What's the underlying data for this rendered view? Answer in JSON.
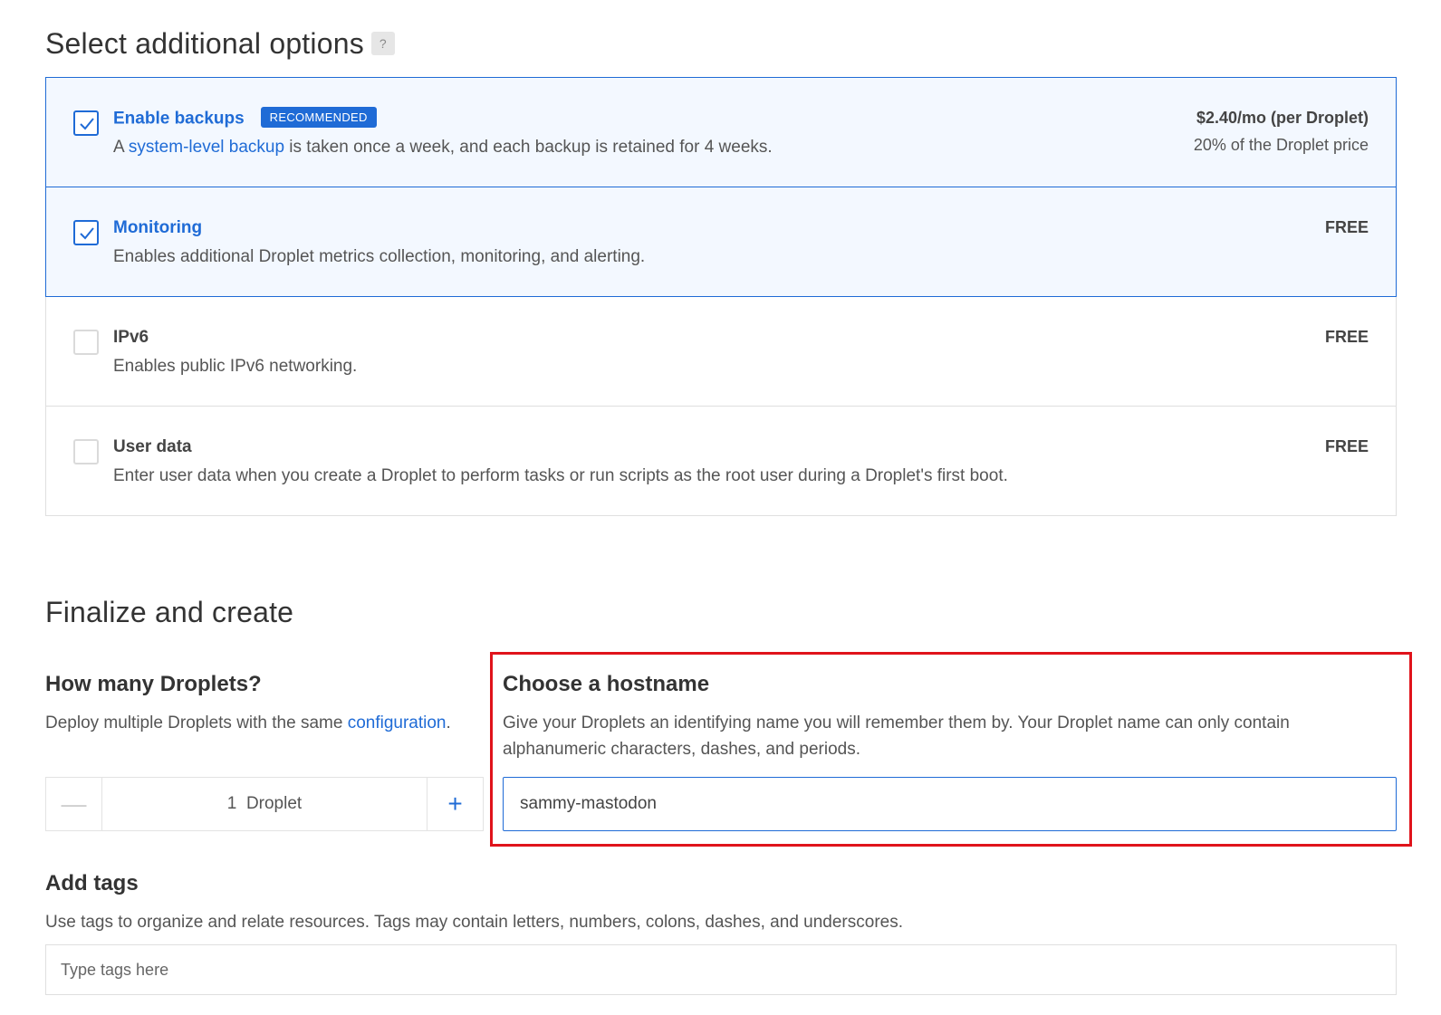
{
  "additional_options": {
    "title": "Select additional options",
    "help_badge": "?",
    "items": [
      {
        "title": "Enable backups",
        "badge": "RECOMMENDED",
        "desc_prefix": "A ",
        "desc_link": "system-level backup",
        "desc_suffix": " is taken once a week, and each backup is retained for 4 weeks.",
        "price": "$2.40/mo (per Droplet)",
        "price_sub": "20% of the Droplet price",
        "checked": true
      },
      {
        "title": "Monitoring",
        "desc": "Enables additional Droplet metrics collection, monitoring, and alerting.",
        "price": "FREE",
        "checked": true
      },
      {
        "title": "IPv6",
        "desc": "Enables public IPv6 networking.",
        "price": "FREE",
        "checked": false
      },
      {
        "title": "User data",
        "desc": "Enter user data when you create a Droplet to perform tasks or run scripts as the root user during a Droplet's first boot.",
        "price": "FREE",
        "checked": false
      }
    ]
  },
  "finalize": {
    "title": "Finalize and create",
    "droplets": {
      "heading": "How many Droplets?",
      "desc_prefix": "Deploy multiple Droplets with the same ",
      "desc_link": "configuration",
      "desc_suffix": ".",
      "minus": "—",
      "plus": "+",
      "count": "1",
      "unit": "Droplet"
    },
    "hostname": {
      "heading": "Choose a hostname",
      "desc": "Give your Droplets an identifying name you will remember them by. Your Droplet name can only contain alphanumeric characters, dashes, and periods.",
      "value": "sammy-mastodon"
    },
    "tags": {
      "heading": "Add tags",
      "desc": "Use tags to organize and relate resources. Tags may contain letters, numbers, colons, dashes, and underscores.",
      "placeholder": "Type tags here"
    }
  },
  "colors": {
    "accent": "#1f6bd6",
    "highlight": "#e0131b",
    "selected_bg": "#f3f8ff"
  }
}
